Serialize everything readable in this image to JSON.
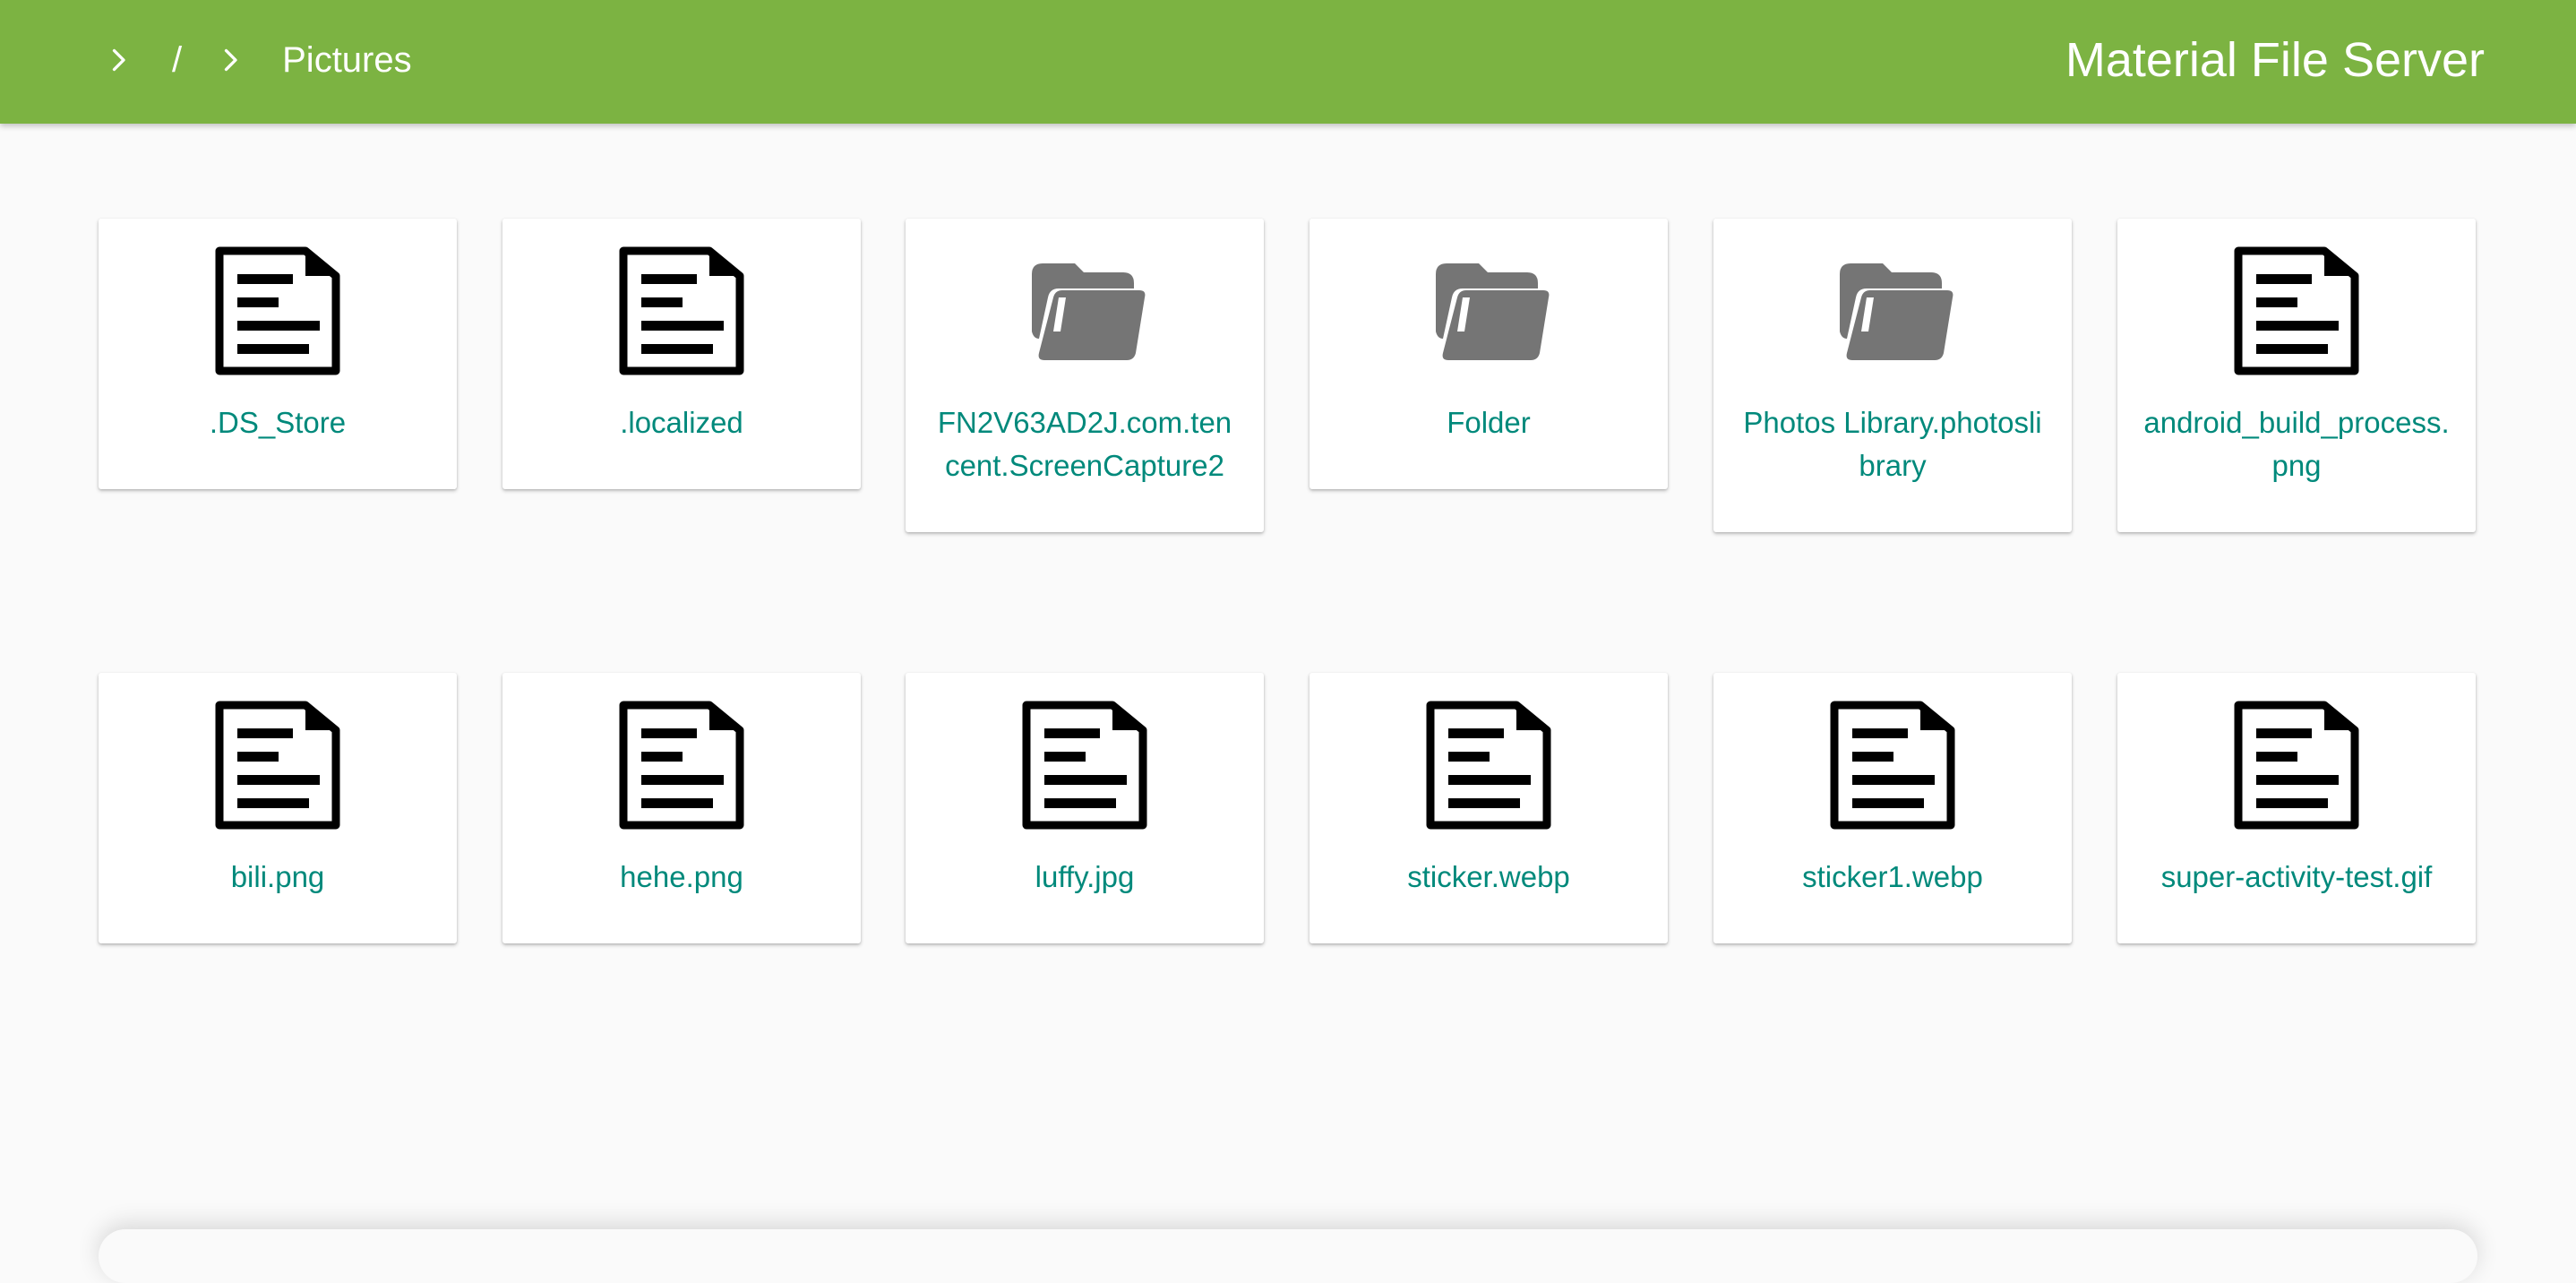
{
  "header": {
    "root_label": "/",
    "current_folder": "Pictures",
    "app_title": "Material File Server",
    "bar_color": "#7cb342"
  },
  "files": [
    {
      "name": ".DS_Store",
      "type": "file",
      "icon": "document-icon"
    },
    {
      "name": ".localized",
      "type": "file",
      "icon": "document-icon"
    },
    {
      "name": "FN2V63AD2J.com.tencent.ScreenCapture2",
      "type": "folder",
      "icon": "folder-icon"
    },
    {
      "name": "Folder",
      "type": "folder",
      "icon": "folder-icon"
    },
    {
      "name": "Photos Library.photoslibrary",
      "type": "folder",
      "icon": "folder-icon"
    },
    {
      "name": "android_build_process.png",
      "type": "file",
      "icon": "document-icon"
    },
    {
      "name": "bili.png",
      "type": "file",
      "icon": "document-icon"
    },
    {
      "name": "hehe.png",
      "type": "file",
      "icon": "document-icon"
    },
    {
      "name": "luffy.jpg",
      "type": "file",
      "icon": "document-icon"
    },
    {
      "name": "sticker.webp",
      "type": "file",
      "icon": "document-icon"
    },
    {
      "name": "sticker1.webp",
      "type": "file",
      "icon": "document-icon"
    },
    {
      "name": "super-activity-test.gif",
      "type": "file",
      "icon": "document-icon"
    }
  ],
  "colors": {
    "file_name": "#00897b",
    "folder_icon": "#757575",
    "document_icon": "#000000"
  }
}
